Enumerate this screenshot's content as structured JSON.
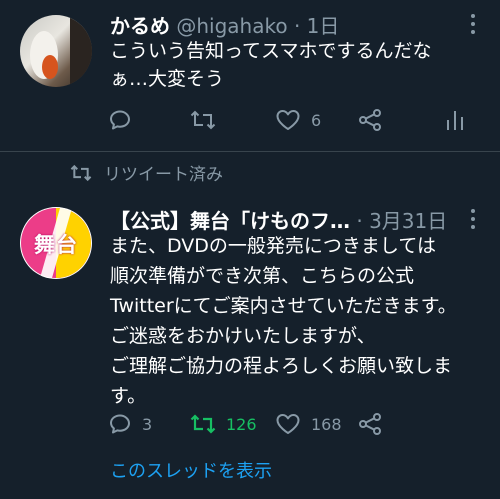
{
  "tweet1": {
    "display_name": "かるめ",
    "handle": "@higahako",
    "sep": "·",
    "time": "1日",
    "text": "こういう告知ってスマホでするんだな\nぁ…大変そう",
    "like_count": "6"
  },
  "retweet_context": {
    "label": "リツイート済み"
  },
  "tweet2": {
    "display_name": "【公式】舞台「けものフ…",
    "sep": "·",
    "time": "3月31日",
    "avatar_text": "舞台",
    "text": "また、DVDの一般発売につきましては\n順次準備ができ次第、こちらの公式\nTwitterにてご案内させていただきます。\nご迷惑をおかけいたしますが、\nご理解ご協力の程よろしくお願い致しま\nす。",
    "reply_count": "3",
    "retweet_count": "126",
    "like_count": "168"
  },
  "thread_link": "このスレッドを表示",
  "colors": {
    "background": "#15202b",
    "muted": "#8899a6",
    "retweet_active": "#17bf63",
    "link": "#1da1f2",
    "avatar_pink": "#ec3d88",
    "avatar_yellow": "#ffd200"
  }
}
